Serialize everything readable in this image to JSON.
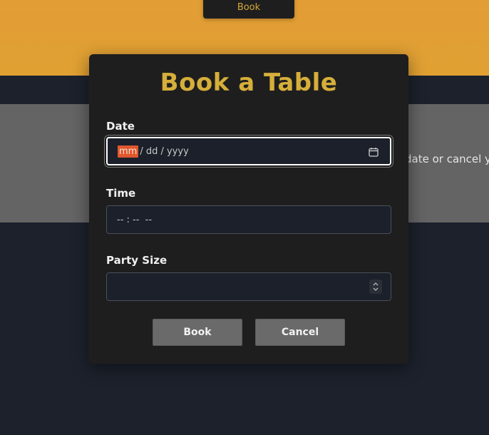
{
  "background": {
    "hero_button_label": "Book",
    "grey_band_text": "date or cancel yo"
  },
  "modal": {
    "title": "Book a Table",
    "date": {
      "label": "Date",
      "segments": [
        "mm",
        "/ dd / yyyy"
      ],
      "icon": "calendar-icon"
    },
    "time": {
      "label": "Time",
      "placeholder": "-- : --  --"
    },
    "party": {
      "label": "Party Size",
      "value": "",
      "icon": "spinner-icon"
    },
    "buttons": {
      "book_label": "Book",
      "cancel_label": "Cancel"
    }
  },
  "colors": {
    "hero": "#e39d35",
    "modal_bg": "#1e1e1e",
    "title": "#d6ae3a",
    "segment_highlight": "#e0572d",
    "button_bg": "#6a6a6a"
  }
}
